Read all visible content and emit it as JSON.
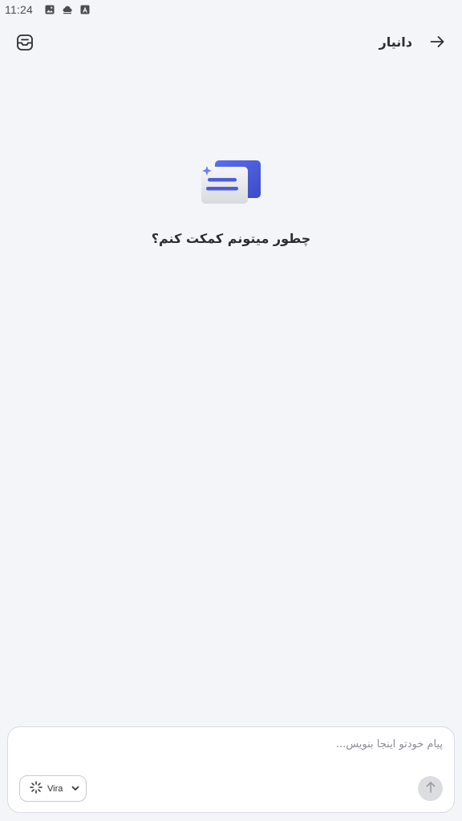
{
  "status_bar": {
    "time": "11:24",
    "icons": [
      "image-icon",
      "cloud-sync-icon",
      "accessibility-icon"
    ]
  },
  "header": {
    "title": "دانیار",
    "menu_icon": "inbox-icon",
    "back_icon": "arrow-right-icon"
  },
  "hero": {
    "illustration": "chat-cards-icon",
    "prompt": "چطور میتونم کمکت کنم؟"
  },
  "composer": {
    "placeholder": "پیام خودتو اینجا بنویس...",
    "value": "",
    "model": "Vira",
    "model_icon": "loading-spinner-icon",
    "dropdown_icon": "chevron-down-icon",
    "send_icon": "arrow-up-icon"
  },
  "colors": {
    "background": "#f4f5f9",
    "accent": "#4a5fd6",
    "text": "#2b2d33",
    "send_disabled": "#dcdde1"
  }
}
